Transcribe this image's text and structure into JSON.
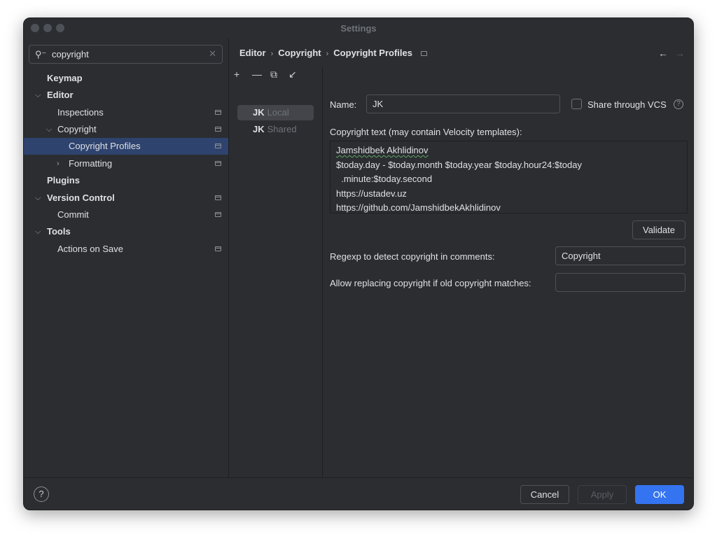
{
  "window": {
    "title": "Settings"
  },
  "search": {
    "value": "copyright"
  },
  "tree": [
    {
      "label": "Keymap"
    },
    {
      "label": "Editor"
    },
    {
      "label": "Inspections"
    },
    {
      "label": "Copyright"
    },
    {
      "label": "Copyright Profiles"
    },
    {
      "label": "Formatting"
    },
    {
      "label": "Plugins"
    },
    {
      "label": "Version Control"
    },
    {
      "label": "Commit"
    },
    {
      "label": "Tools"
    },
    {
      "label": "Actions on Save"
    }
  ],
  "breadcrumb": [
    "Editor",
    "Copyright",
    "Copyright Profiles"
  ],
  "profiles": [
    {
      "name": "JK",
      "scope": "Local"
    },
    {
      "name": "JK",
      "scope": "Shared"
    }
  ],
  "form": {
    "name_label": "Name:",
    "name_value": "JK",
    "share_label": "Share through VCS",
    "copyright_text_label": "Copyright text (may contain Velocity templates):",
    "copyright_lines": [
      "Jamshidbek Akhlidinov",
      "$today.day - $today.month $today.year $today.hour24:$today",
      "  .minute:$today.second",
      "https://ustadev.uz",
      "https://github.com/JamshidbekAkhlidinov"
    ],
    "validate_label": "Validate",
    "regexp_label": "Regexp to detect copyright in comments:",
    "regexp_value": "Copyright",
    "allow_label": "Allow replacing copyright if old copyright matches:",
    "allow_value": ""
  },
  "footer": {
    "cancel": "Cancel",
    "apply": "Apply",
    "ok": "OK"
  }
}
